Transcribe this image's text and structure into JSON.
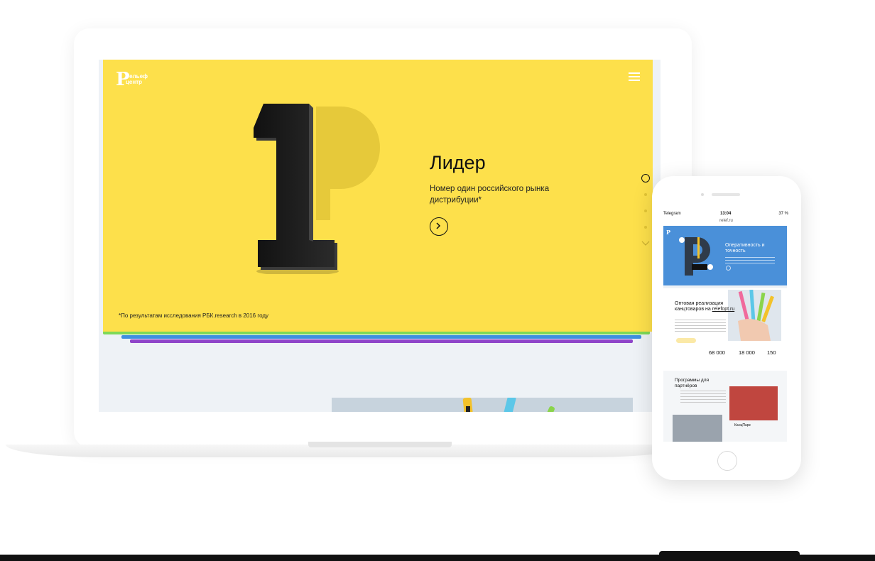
{
  "desktop": {
    "logo": {
      "line1": "Рельеф",
      "line2": "центр"
    },
    "hero": {
      "title": "Лидер",
      "subtitle": "Номер один российского рынка дистрибуции*",
      "footnote": "*По результатам исследования РБК.research в 2016 году"
    },
    "colors": {
      "slide": "#fde04b",
      "green": "#7ed957",
      "blue": "#3f8fe0",
      "purple": "#8f45c9",
      "accent_dark": "#1f1f1f"
    },
    "pagination": {
      "active": 1,
      "total": 4
    }
  },
  "mobile": {
    "status": {
      "app": "Telegram",
      "time": "13:04",
      "battery": "37 %"
    },
    "url": "relef.ru",
    "hero": {
      "title": "Оперативность и точность"
    },
    "wholesale": {
      "title_prefix": "Оптовая реализация канцтоваров на ",
      "title_link": "relefopt.ru",
      "stats": [
        "68 000",
        "18 000",
        "150"
      ]
    },
    "partners": {
      "title": "Программы для партнёров",
      "item_label": "КанцПарк"
    }
  }
}
